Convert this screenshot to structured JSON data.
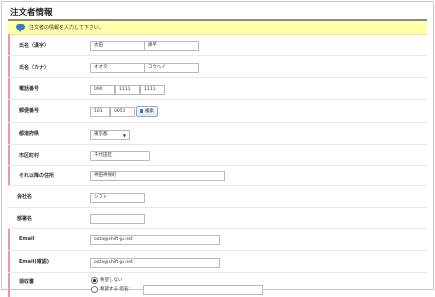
{
  "page": {
    "title": "注文者情報",
    "notice": "注文者の情報を入力して下さい。"
  },
  "form": {
    "name_kanji": {
      "label": "氏名（漢字）",
      "last": "太田",
      "first": "耕平"
    },
    "name_kana": {
      "label": "氏名（カナ）",
      "last": "オオタ",
      "first": "コウヘイ"
    },
    "phone": {
      "label": "電話番号",
      "p1": "090",
      "p2": "1111",
      "p3": "1111"
    },
    "postal": {
      "label": "郵便番号",
      "p1": "101",
      "p2": "0051",
      "search_button": "検索"
    },
    "prefecture": {
      "label": "都道府県",
      "value": "東京都"
    },
    "city": {
      "label": "市区町村",
      "value": "千代田区"
    },
    "address": {
      "label": "それ以降の住所",
      "value": "神田神保町"
    },
    "company": {
      "label": "会社名",
      "value": "シフト"
    },
    "department": {
      "label": "部署名",
      "value": ""
    },
    "email": {
      "label": "Email",
      "value": "oota@shift-jp.net"
    },
    "email_confirm": {
      "label": "Email(確認)",
      "value": "oota@shift-jp.net"
    },
    "receipt": {
      "label": "領収書",
      "option_no": "希望しない",
      "option_yes": "希望する 宛名：",
      "addressee": ""
    }
  }
}
